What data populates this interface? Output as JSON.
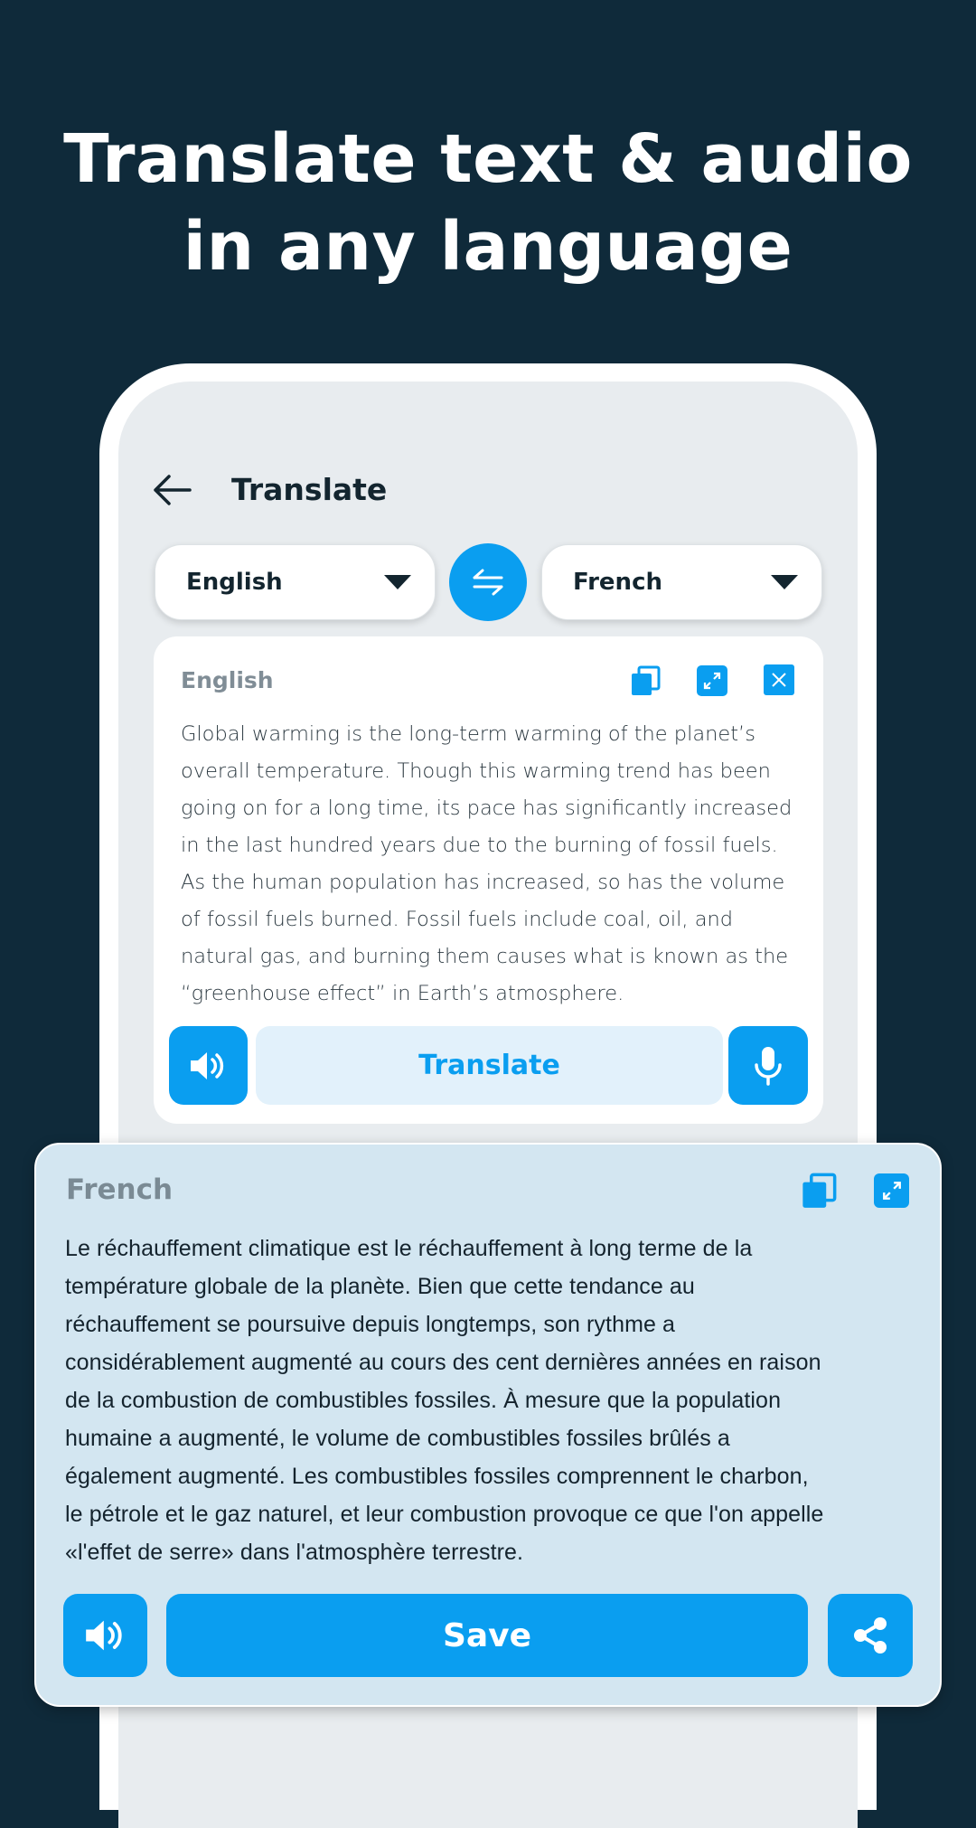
{
  "headline": {
    "line1": "Translate text & audio",
    "line2": "in any language"
  },
  "header": {
    "title": "Translate",
    "back_icon": "arrow-left-icon"
  },
  "languages": {
    "source": "English",
    "target": "French",
    "swap_icon": "swap-arrows-icon"
  },
  "source_card": {
    "label": "English",
    "icons": [
      "copy-icon",
      "expand-icon",
      "close-icon"
    ],
    "text_lines": [
      "Global warming is the long-term warming of the planet’s",
      "overall temperature. Though this warming trend has been",
      "going on for a long time, its pace has significantly increased",
      "in the last hundred years due to the burning of fossil fuels.",
      "As the human population has increased, so has the volume",
      "of fossil fuels burned. Fossil fuels include coal, oil, and",
      "natural gas, and burning them causes what is known as the",
      "“greenhouse effect” in Earth’s atmosphere."
    ],
    "translate_label": "Translate"
  },
  "output_card": {
    "label": "French",
    "icons": [
      "copy-icon",
      "expand-icon"
    ],
    "text_lines": [
      "Le réchauffement climatique est le réchauffement à long terme de la",
      "température globale de la planète. Bien que cette tendance au",
      "réchauffement se poursuive depuis longtemps, son rythme a",
      "considérablement augmenté au cours des cent dernières années en raison",
      "de la combustion de combustibles fossiles. À mesure que la population",
      "humaine a augmenté, le volume de combustibles fossiles brûlés a",
      "également augmenté. Les combustibles fossiles comprennent le charbon,",
      "le pétrole et le gaz naturel, et leur combustion provoque ce que l'on appelle",
      "«l'effet de serre» dans l'atmosphère terrestre."
    ],
    "save_label": "Save"
  },
  "colors": {
    "background": "#0f2a3a",
    "accent": "#0a9ef0",
    "output_bg": "#d3e6f1",
    "screen_bg": "#e8ecef"
  }
}
